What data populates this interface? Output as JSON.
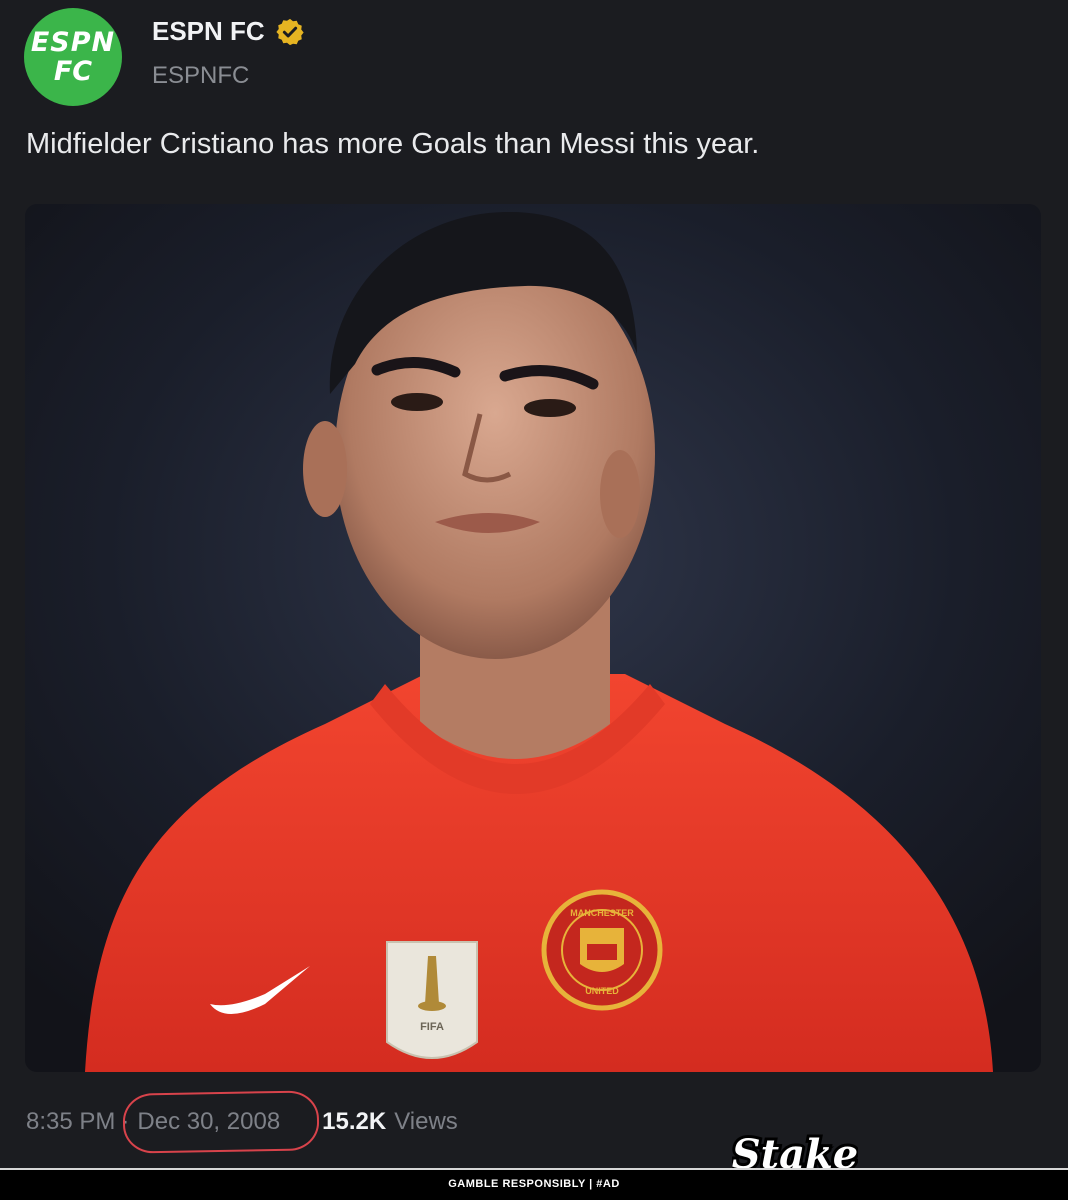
{
  "post": {
    "author": {
      "display_name": "ESPN FC",
      "handle": "ESPNFC",
      "avatar_line1": "ESPN",
      "avatar_line2": "FC",
      "verified_icon": "verified-badge-gold"
    },
    "text": "Midfielder Cristiano has more Goals than Messi this year.",
    "media": {
      "kit_badge_text": "FIFA",
      "crest_top": "MANCHESTER",
      "crest_bottom": "UNITED"
    },
    "time": "8:35 PM",
    "separator": "·",
    "date": "Dec 30, 2008",
    "views_count": "15.2K",
    "views_label": "Views"
  },
  "ad": {
    "brand": "Stake",
    "disclaimer": "GAMBLE RESPONSIBLY  |  #AD"
  },
  "colors": {
    "background": "#1a1b1f",
    "avatar": "#3bb54a",
    "verified": "#e6b422",
    "annotation_circle": "#d8434b",
    "jersey": "#e8372a"
  }
}
